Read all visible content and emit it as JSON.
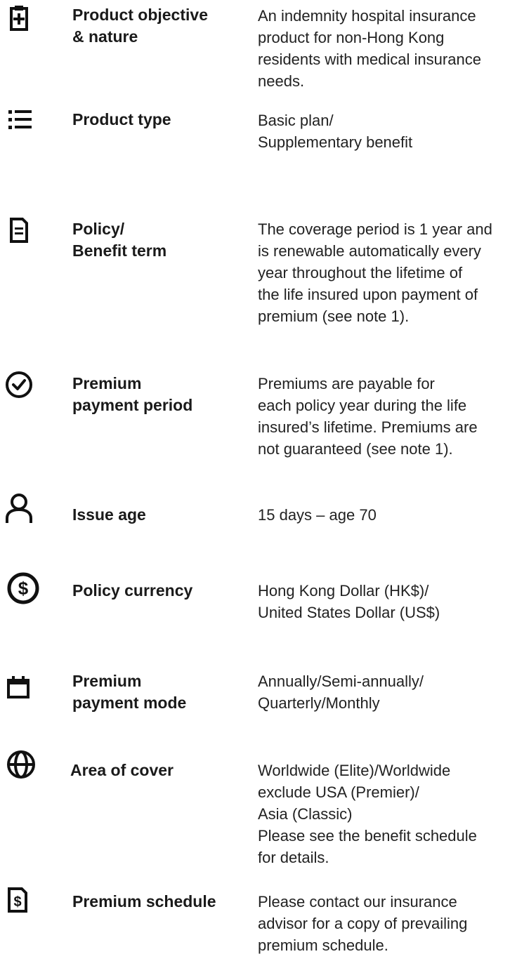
{
  "items": [
    {
      "icon": "clipboard-plus-icon",
      "label": "Product objective\n& nature",
      "value": "An indemnity hospital insurance\nproduct for non-Hong Kong\nresidents with medical insurance\nneeds."
    },
    {
      "icon": "list-icon",
      "label": "Product type",
      "value": "Basic plan/\nSupplementary benefit"
    },
    {
      "icon": "document-icon",
      "label": "Policy/\nBenefit term",
      "value": "The coverage period is 1 year and\nis renewable automatically every\nyear throughout the lifetime of\nthe life insured upon payment of\npremium (see note 1)."
    },
    {
      "icon": "check-circle-icon",
      "label": "Premium\npayment period",
      "value": "Premiums are payable for\neach policy year during the life\ninsured’s lifetime. Premiums are\nnot guaranteed (see note 1)."
    },
    {
      "icon": "person-icon",
      "label": "Issue age",
      "value": "15 days – age 70"
    },
    {
      "icon": "dollar-circle-icon",
      "label": "Policy currency",
      "value": "Hong Kong Dollar (HK$)/\nUnited States Dollar (US$)"
    },
    {
      "icon": "calendar-icon",
      "label": "Premium\npayment mode",
      "value": "Annually/Semi-annually/\nQuarterly/Monthly"
    },
    {
      "icon": "globe-icon",
      "label": "Area of cover",
      "value": "Worldwide (Elite)/Worldwide\nexclude USA (Premier)/\nAsia (Classic)\nPlease see the benefit schedule\nfor details."
    },
    {
      "icon": "dollar-document-icon",
      "label": "Premium schedule",
      "value": "Please contact our insurance\nadvisor for a copy of prevailing\npremium schedule."
    }
  ]
}
